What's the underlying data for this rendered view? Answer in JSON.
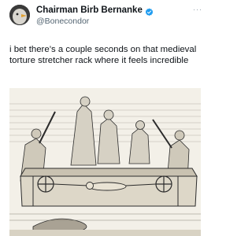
{
  "tweet": {
    "display_name": "Chairman Birb Bernanke",
    "handle": "@Bonecondor",
    "text": "i bet there’s a couple seconds on that medieval torture stretcher rack where it feels incredible",
    "more_label": "···"
  },
  "icons": {
    "verified": "verified-badge-icon",
    "more": "more-options-icon"
  },
  "colors": {
    "verified": "#1d9bf0",
    "text": "#0f1419",
    "secondary": "#536471",
    "engraving_paper": "#f3f0e8",
    "engraving_ink": "#2b2b2b"
  }
}
